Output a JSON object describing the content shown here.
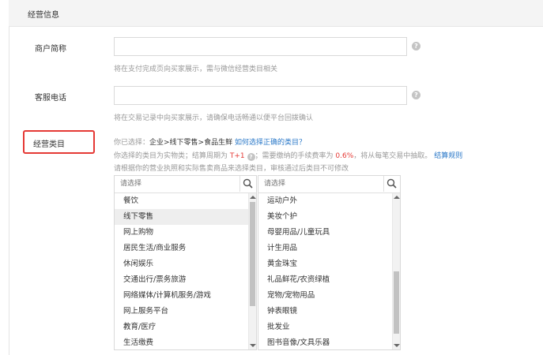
{
  "section": {
    "title": "经营信息"
  },
  "merchant": {
    "label": "商户简称",
    "value": "",
    "hint": "将在支付完成页向买家展示，需与微信经营类目相关"
  },
  "phone": {
    "label": "客服电话",
    "value": "",
    "hint": "将在交易记录中向买家展示，请确保电话畅通以便平台回拨确认"
  },
  "category": {
    "label": "经营类目",
    "selected_prefix": "你已选择：",
    "selected_value": "企业>线下零售>食品生鲜",
    "how_link": "如何选择正确的类目？",
    "line2_a": "你选择的类目为实物类；结算周期为",
    "period": "T+1",
    "line2_b": "；需要缴纳的手续费率为",
    "rate": "0.6%",
    "line2_c": "，将从每笔交易中抽取。",
    "rules_link": "结算规则",
    "line3": "请根据你的营业执照和实际售卖商品来选择类目，审核通过后类目不可修改",
    "search_placeholder": "请选择",
    "left_items": [
      "餐饮",
      "线下零售",
      "网上购物",
      "居民生活/商业服务",
      "休闲娱乐",
      "交通出行/票务旅游",
      "网络媒体/计算机服务/游戏",
      "网上服务平台",
      "教育/医疗",
      "生活缴费"
    ],
    "right_items": [
      "运动户外",
      "美妆个护",
      "母婴用品/儿童玩具",
      "计生用品",
      "黄金珠宝",
      "礼品鲜花/农资绿植",
      "宠物/宠物用品",
      "钟表眼镜",
      "批发业",
      "图书音像/文具乐器"
    ],
    "left_selected_index": 1,
    "left_scroll": {
      "thumb_start": 0.0,
      "thumb_end": 0.75
    },
    "right_scroll": {
      "thumb_start": 0.5,
      "thumb_end": 0.95
    }
  },
  "colors": {
    "highlight": "#e53935",
    "link": "#2a78c8",
    "rate": "#e53935"
  },
  "icons": {
    "help": "question-circle-icon",
    "search": "search-icon"
  }
}
